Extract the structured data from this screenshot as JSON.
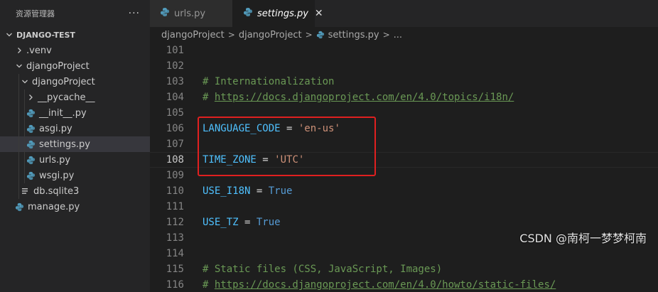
{
  "sidebar": {
    "title": "资源管理器",
    "more_label": "···",
    "section_title": "DJANGO-TEST",
    "tree": [
      {
        "label": ".venv",
        "kind": "folder",
        "state": "collapsed"
      },
      {
        "label": "djangoProject",
        "kind": "folder",
        "state": "expanded"
      },
      {
        "label": "djangoProject",
        "kind": "folder",
        "state": "expanded"
      },
      {
        "label": "__pycache__",
        "kind": "folder",
        "state": "collapsed"
      },
      {
        "label": "__init__.py",
        "kind": "python"
      },
      {
        "label": "asgi.py",
        "kind": "python"
      },
      {
        "label": "settings.py",
        "kind": "python",
        "selected": true
      },
      {
        "label": "urls.py",
        "kind": "python"
      },
      {
        "label": "wsgi.py",
        "kind": "python"
      },
      {
        "label": "db.sqlite3",
        "kind": "file"
      },
      {
        "label": "manage.py",
        "kind": "python"
      }
    ]
  },
  "tabs": [
    {
      "label": "urls.py",
      "active": false
    },
    {
      "label": "settings.py",
      "active": true,
      "close_label": "✕"
    }
  ],
  "breadcrumb": {
    "items": [
      "djangoProject",
      "djangoProject",
      "settings.py",
      "..."
    ],
    "separator": ">"
  },
  "editor": {
    "current_line": "108",
    "lines": [
      {
        "num": "101",
        "tokens": []
      },
      {
        "num": "102",
        "tokens": []
      },
      {
        "num": "103",
        "tokens": [
          {
            "t": "# Internationalization",
            "c": "comment"
          }
        ]
      },
      {
        "num": "104",
        "tokens": [
          {
            "t": "# ",
            "c": "comment"
          },
          {
            "t": "https://docs.djangoproject.com/en/4.0/topics/i18n/",
            "c": "link"
          }
        ]
      },
      {
        "num": "105",
        "tokens": []
      },
      {
        "num": "106",
        "tokens": [
          {
            "t": "LANGUAGE_CODE",
            "c": "var"
          },
          {
            "t": " = ",
            "c": "op"
          },
          {
            "t": "'en-us'",
            "c": "str"
          }
        ]
      },
      {
        "num": "107",
        "tokens": []
      },
      {
        "num": "108",
        "tokens": [
          {
            "t": "TIME_ZONE",
            "c": "var"
          },
          {
            "t": " = ",
            "c": "op"
          },
          {
            "t": "'UTC'",
            "c": "str"
          }
        ]
      },
      {
        "num": "109",
        "tokens": []
      },
      {
        "num": "110",
        "tokens": [
          {
            "t": "USE_I18N",
            "c": "var"
          },
          {
            "t": " = ",
            "c": "op"
          },
          {
            "t": "True",
            "c": "const"
          }
        ]
      },
      {
        "num": "111",
        "tokens": []
      },
      {
        "num": "112",
        "tokens": [
          {
            "t": "USE_TZ",
            "c": "var"
          },
          {
            "t": " = ",
            "c": "op"
          },
          {
            "t": "True",
            "c": "const"
          }
        ]
      },
      {
        "num": "113",
        "tokens": []
      },
      {
        "num": "114",
        "tokens": []
      },
      {
        "num": "115",
        "tokens": [
          {
            "t": "# Static files (CSS, JavaScript, Images)",
            "c": "comment"
          }
        ]
      },
      {
        "num": "116",
        "tokens": [
          {
            "t": "# ",
            "c": "comment"
          },
          {
            "t": "https://docs.djangoproject.com/en/4.0/howto/static-files/",
            "c": "link"
          }
        ]
      }
    ]
  },
  "watermark": "CSDN @南柯一梦梦柯南",
  "colors": {
    "highlight_box": "#e02020",
    "python_icon": "#519aba",
    "selected_row": "#37373d"
  }
}
